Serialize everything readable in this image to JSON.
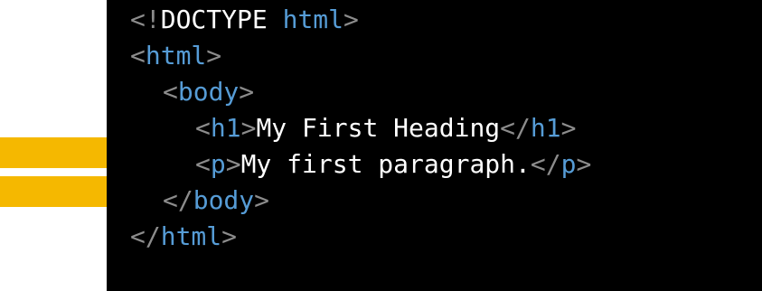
{
  "code": {
    "doctype_open": "<!",
    "doctype_keyword": "DOCTYPE",
    "doctype_space": " ",
    "doctype_name": "html",
    "doctype_close": ">",
    "lt": "<",
    "gt": ">",
    "lt_slash": "</",
    "html_tag": "html",
    "body_tag": "body",
    "h1_tag": "h1",
    "p_tag": "p",
    "h1_text": "My First Heading",
    "p_text": "My first paragraph."
  },
  "colors": {
    "background": "#000000",
    "bracket": "#8c8c8c",
    "tag": "#569cd6",
    "text": "#ffffff",
    "arrow": "#f5b800"
  },
  "annotations": {
    "arrow_icon": "right-arrow-icon"
  }
}
